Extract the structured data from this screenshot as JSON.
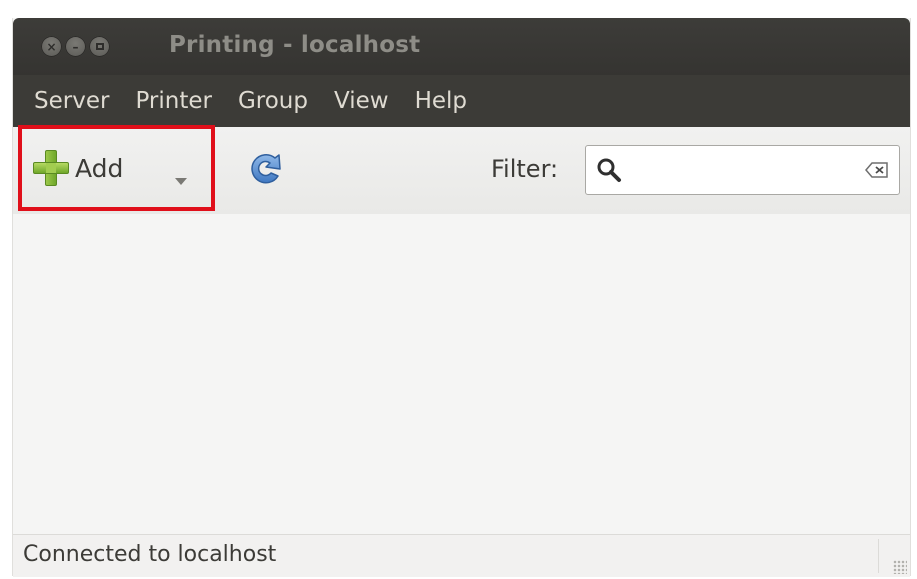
{
  "window": {
    "title": "Printing - localhost"
  },
  "menubar": {
    "items": [
      {
        "label": "Server"
      },
      {
        "label": "Printer"
      },
      {
        "label": "Group"
      },
      {
        "label": "View"
      },
      {
        "label": "Help"
      }
    ]
  },
  "toolbar": {
    "add_label": "Add",
    "add_icon": "green-plus-icon",
    "refresh_icon": "refresh-icon",
    "filter_label": "Filter:",
    "filter_value": "",
    "highlight_color": "#e00f1a"
  },
  "statusbar": {
    "text": "Connected to localhost"
  }
}
